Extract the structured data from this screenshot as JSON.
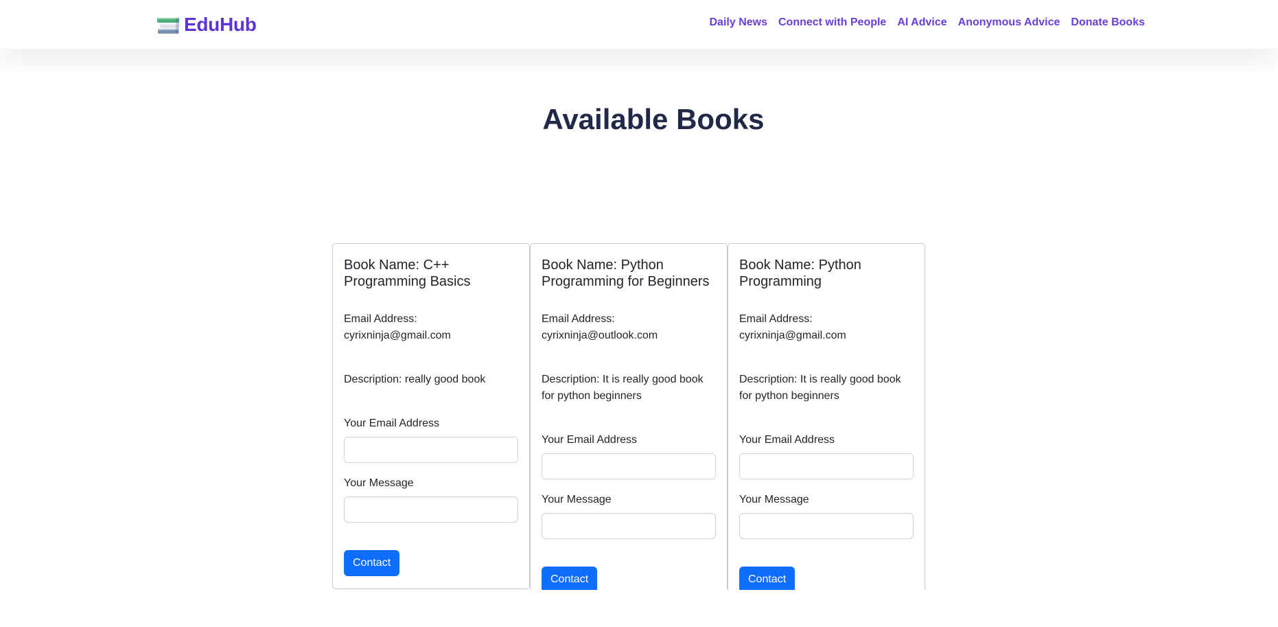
{
  "navbar": {
    "brand": "EduHub",
    "links": [
      "Daily News",
      "Connect with People",
      "AI Advice",
      "Anonymous Advice",
      "Donate Books"
    ]
  },
  "page": {
    "title": "Available Books"
  },
  "cards": [
    {
      "book_name": "Book Name: C++ Programming Basics",
      "email_label": "Email Address:",
      "email": "cyrixninja@gmail.com",
      "description": "Description: really good book",
      "your_email_label": "Your Email Address",
      "your_email_value": "",
      "your_message_label": "Your Message",
      "your_message_value": "",
      "button": "Contact"
    },
    {
      "book_name": "Book Name: Python Programming for Beginners",
      "email_label": "Email Address:",
      "email": "cyrixninja@outlook.com",
      "description": "Description: It is really good book for python beginners",
      "your_email_label": "Your Email Address",
      "your_email_value": "",
      "your_message_label": "Your Message",
      "your_message_value": "",
      "button": "Contact"
    },
    {
      "book_name": "Book Name: Python Programming",
      "email_label": "Email Address:",
      "email": "cyrixninja@gmail.com",
      "description": "Description: It is really good book for python beginners",
      "your_email_label": "Your Email Address",
      "your_email_value": "",
      "your_message_label": "Your Message",
      "your_message_value": "",
      "button": "Contact"
    }
  ],
  "colors": {
    "brand": "#5b33d6",
    "nav_link": "#6a3fd6",
    "title": "#222848",
    "button": "#0d6efd"
  },
  "icons": {
    "logo": "books-stack-icon"
  }
}
